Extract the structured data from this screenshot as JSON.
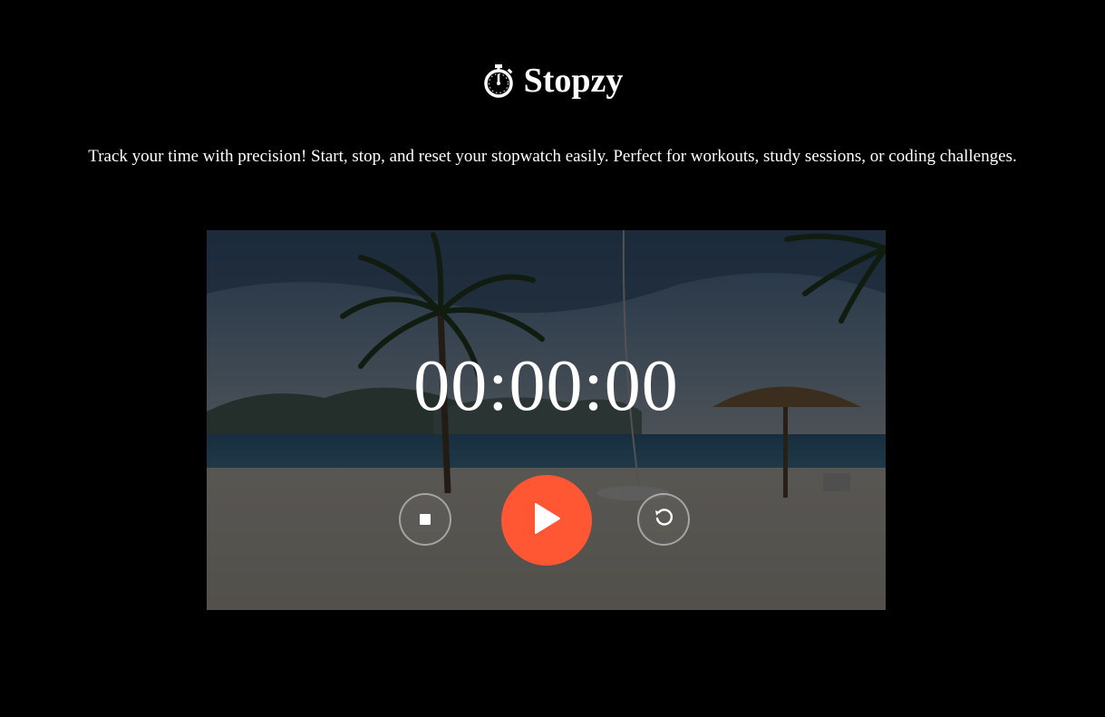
{
  "app": {
    "title": "Stopzy",
    "title_icon": "stopwatch-icon",
    "description": "Track your time with precision! Start, stop, and reset your stopwatch easily. Perfect for workouts, study sessions, or coding challenges."
  },
  "stopwatch": {
    "time": "00:00:00",
    "controls": {
      "stop_icon": "stop-icon",
      "play_icon": "play-icon",
      "reset_icon": "reset-icon"
    }
  },
  "colors": {
    "background": "#000000",
    "accent": "#ff5733",
    "text": "#ffffff"
  }
}
